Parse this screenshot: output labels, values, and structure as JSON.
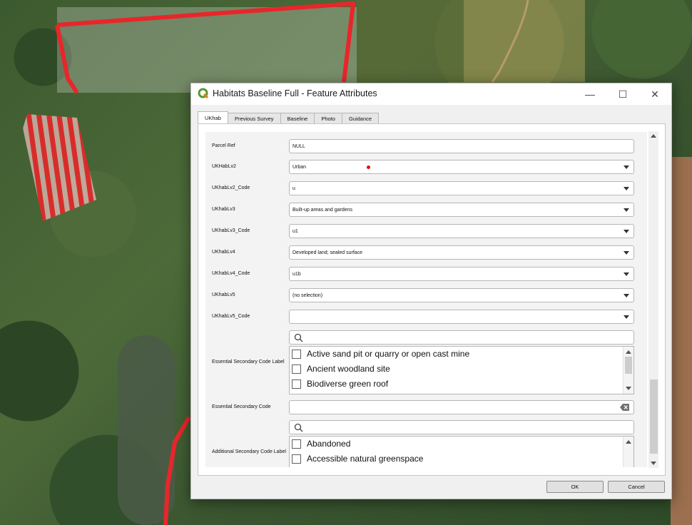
{
  "window": {
    "title": "Habitats Baseline Full - Feature Attributes",
    "minimize_glyph": "—",
    "maximize_glyph": "☐",
    "close_glyph": "✕"
  },
  "tabs": [
    {
      "label": "UKhab",
      "active": true
    },
    {
      "label": "Previous Survey",
      "active": false
    },
    {
      "label": "Baseline",
      "active": false
    },
    {
      "label": "Photo",
      "active": false
    },
    {
      "label": "Guidance",
      "active": false
    }
  ],
  "form": {
    "parcel_ref": {
      "label": "Parcel Ref",
      "value": "NULL"
    },
    "ukhablv2": {
      "label": "UKHabLv2",
      "value": "Urban"
    },
    "ukhablv2_code": {
      "label": "UKhabLv2_Code",
      "value": "u"
    },
    "ukhablv3": {
      "label": "UKhabLv3",
      "value": "Built-up areas and gardens"
    },
    "ukhablv3_code": {
      "label": "UKhabLv3_Code",
      "value": "u1"
    },
    "ukhablv4": {
      "label": "UKhabLv4",
      "value": "Developed land; sealed surface"
    },
    "ukhablv4_code": {
      "label": "UKhabLv4_Code",
      "value": "u1b"
    },
    "ukhablv5": {
      "label": "UKhabLv5",
      "value": "(no selection)"
    },
    "ukhablv5_code": {
      "label": "UKhabLv5_Code",
      "value": ""
    },
    "essential_secondary_label": {
      "label": "Essential Secondary Code Label",
      "search_value": "",
      "items": [
        "Active sand pit or quarry or open cast mine",
        "Ancient woodland site",
        "Biodiverse green roof"
      ]
    },
    "essential_secondary_code": {
      "label": "Essential Secondary Code",
      "value": ""
    },
    "additional_secondary_label": {
      "label": "Additional Secondary Code Label",
      "search_value": "",
      "items": [
        "Abandoned",
        "Accessible natural greenspace"
      ]
    }
  },
  "buttons": {
    "ok": "OK",
    "cancel": "Cancel"
  },
  "colors": {
    "boundary": "#e8262a",
    "required_dot": "#e01010",
    "qgis_green": "#589632"
  }
}
